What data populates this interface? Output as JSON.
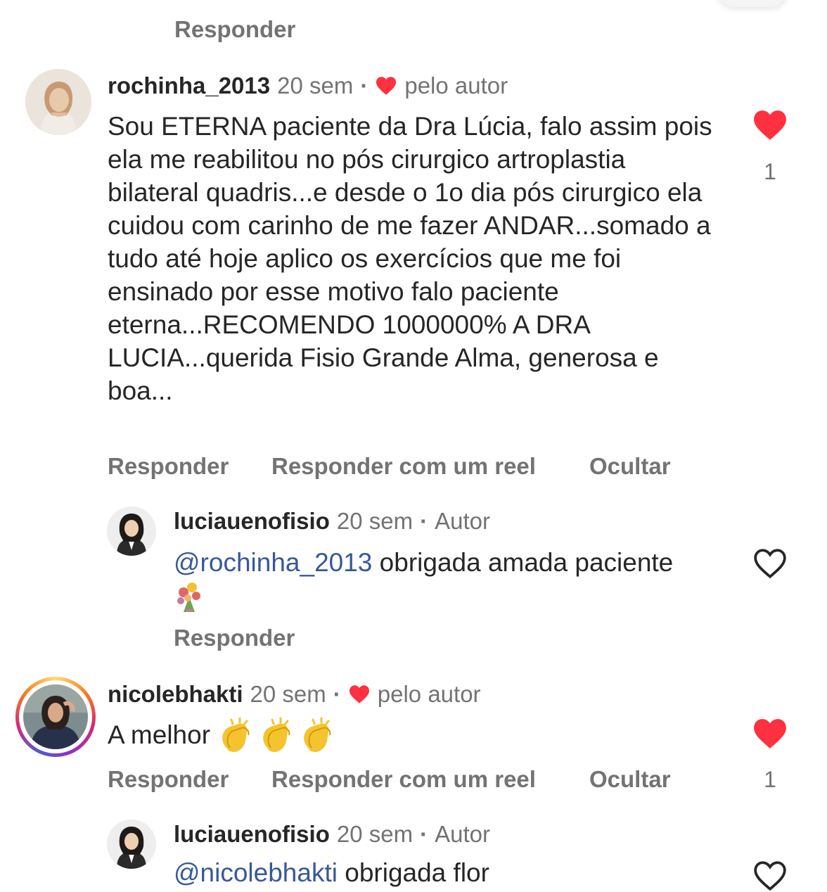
{
  "comments": [
    {
      "username": "rochinha_2013",
      "time": "20 sem",
      "separator": "·",
      "liked_by_author": "pelo autor",
      "text": "Sou ETERNA paciente da Dra Lúcia, falo assim pois ela me reabilitou no pós cirurgico artroplastia bilateral quadris...e desde o 1o dia pós cirurgico ela cuidou com carinho de me fazer ANDAR...somado a tudo até hoje aplico os exercícios que me foi ensinado por esse motivo falo paciente eterna...RECOMENDO 1000000% A DRA LUCIA...querida Fisio Grande Alma, generosa e boa...",
      "actions": [
        "Responder",
        "Responder com um reel",
        "Ocultar"
      ],
      "like_count": "1",
      "reply": {
        "username": "luciauenofisio",
        "time": "20 sem",
        "separator": "·",
        "role": "Autor",
        "mention": "@rochinha_2013",
        "text": " obrigada amada paciente",
        "emoji": "bouquet",
        "action": "Responder"
      }
    },
    {
      "username": "nicolebhakti",
      "time": "20 sem",
      "separator": "·",
      "liked_by_author": "pelo autor",
      "text": "A melhor",
      "emoji": "clapping-hands x3",
      "actions": [
        "Responder",
        "Responder com um reel",
        "Ocultar"
      ],
      "like_count": "1",
      "reply": {
        "username": "luciauenofisio",
        "time": "20 sem",
        "separator": "·",
        "role": "Autor",
        "mention": "@nicolebhakti",
        "text": " obrigada flor"
      }
    }
  ],
  "top_action": "Responder",
  "colors": {
    "heart_red": "#ff3040",
    "mention_blue": "#385898",
    "secondary_text": "#737373",
    "primary_text": "#262626"
  },
  "icons": [
    "heart-filled-icon",
    "heart-outline-icon",
    "bouquet-emoji",
    "clapping-hands-emoji"
  ]
}
